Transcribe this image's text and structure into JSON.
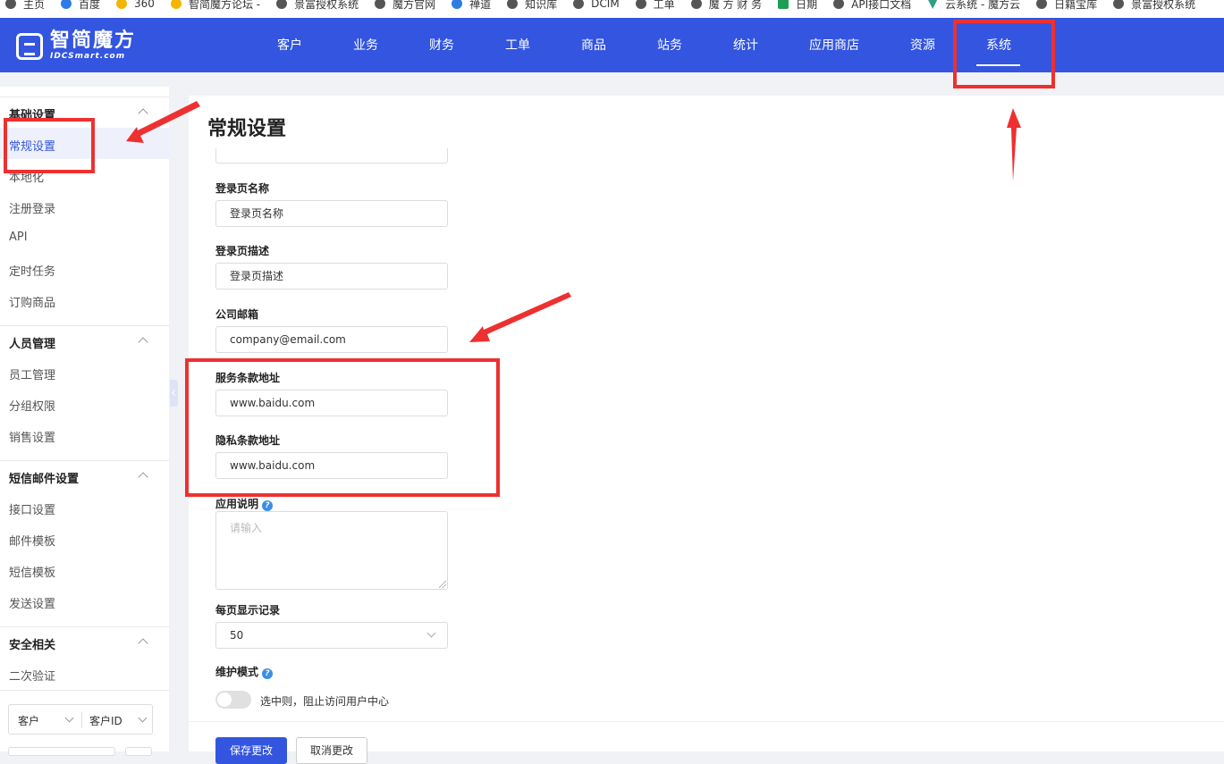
{
  "bookmarks": [
    {
      "label": "主页",
      "icon": "globe-icon"
    },
    {
      "label": "百度",
      "icon": "baidu-icon"
    },
    {
      "label": "360",
      "icon": "360-icon"
    },
    {
      "label": "智简魔方论坛 -",
      "icon": "forum-icon"
    },
    {
      "label": "景富授权系统",
      "icon": "globe-icon"
    },
    {
      "label": "魔方官网",
      "icon": "globe-icon"
    },
    {
      "label": "禅道",
      "icon": "zentao-icon"
    },
    {
      "label": "知识库",
      "icon": "globe-icon"
    },
    {
      "label": "DCIM",
      "icon": "globe-icon"
    },
    {
      "label": "工单",
      "icon": "globe-icon"
    },
    {
      "label": "魔 方 财 务",
      "icon": "globe-icon"
    },
    {
      "label": "日期",
      "icon": "sheet-icon"
    },
    {
      "label": "API接口文档",
      "icon": "globe-icon"
    },
    {
      "label": "云系统 - 魔方云",
      "icon": "vue-icon"
    },
    {
      "label": "日籍宝库",
      "icon": "globe-icon"
    },
    {
      "label": "景富授权系统",
      "icon": "globe-icon"
    }
  ],
  "brand": {
    "name_cn": "智简魔方",
    "name_en": "IDCSmart.com"
  },
  "nav": [
    "客户",
    "业务",
    "财务",
    "工单",
    "商品",
    "站务",
    "统计",
    "应用商店",
    "资源",
    "系统"
  ],
  "sidebar": {
    "sections": [
      {
        "title": "基础设置",
        "items": [
          "常规设置",
          "本地化",
          "注册登录",
          "API",
          "定时任务",
          "订购商品"
        ]
      },
      {
        "title": "人员管理",
        "items": [
          "员工管理",
          "分组权限",
          "销售设置"
        ]
      },
      {
        "title": "短信邮件设置",
        "items": [
          "接口设置",
          "邮件模板",
          "短信模板",
          "发送设置"
        ]
      },
      {
        "title": "安全相关",
        "items": [
          "二次验证"
        ]
      }
    ],
    "filter": {
      "type_value": "客户",
      "field_value": "客户ID"
    }
  },
  "main": {
    "title": "常规设置",
    "fields": {
      "login_name": {
        "label": "登录页名称",
        "value": "登录页名称"
      },
      "login_desc": {
        "label": "登录页描述",
        "value": "登录页描述"
      },
      "company_email": {
        "label": "公司邮箱",
        "value": "company@email.com"
      },
      "terms_url": {
        "label": "服务条款地址",
        "value": "www.baidu.com"
      },
      "privacy_url": {
        "label": "隐私条款地址",
        "value": "www.baidu.com"
      },
      "app_desc": {
        "label": "应用说明",
        "placeholder": "请输入"
      },
      "page_size": {
        "label": "每页显示记录",
        "value": "50"
      },
      "maintenance": {
        "label": "维护模式",
        "toggle_text": "选中则，阻止访问用户中心",
        "enabled": false
      }
    },
    "buttons": {
      "save": "保存更改",
      "cancel": "取消更改"
    }
  },
  "colors": {
    "primary": "#3355e0",
    "annotation": "#ee3030"
  }
}
